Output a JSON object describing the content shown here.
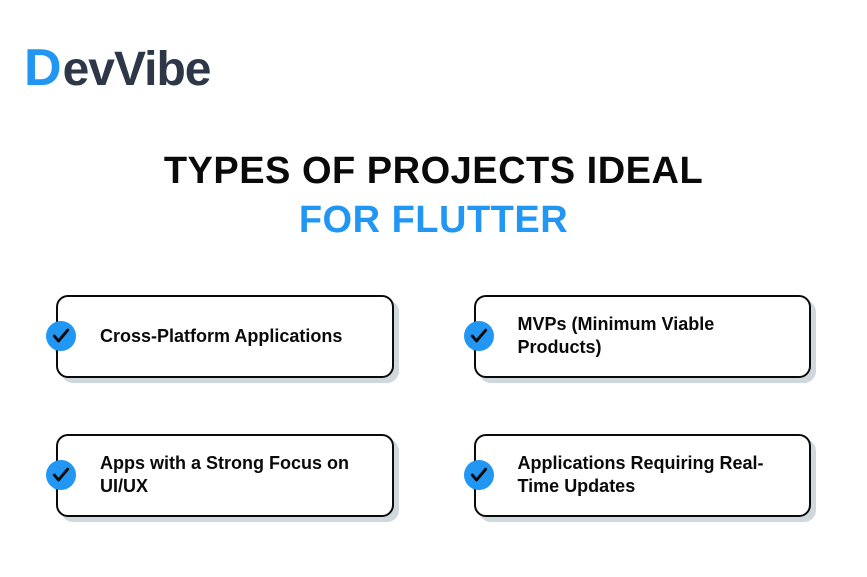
{
  "logo": {
    "letter": "D",
    "rest": "evVibe"
  },
  "heading": {
    "line1": "TYPES OF PROJECTS IDEAL",
    "line2": "FOR FLUTTER"
  },
  "cards": [
    {
      "label": "Cross-Platform Applications"
    },
    {
      "label": "MVPs (Minimum Viable Products)"
    },
    {
      "label": "Apps with a Strong Focus on UI/UX"
    },
    {
      "label": "Applications Requiring Real-Time Updates"
    }
  ],
  "colors": {
    "accent": "#2196F3",
    "text": "#0a0a0a",
    "logoDark": "#2d3748",
    "shadow": "#cfd8dc"
  }
}
